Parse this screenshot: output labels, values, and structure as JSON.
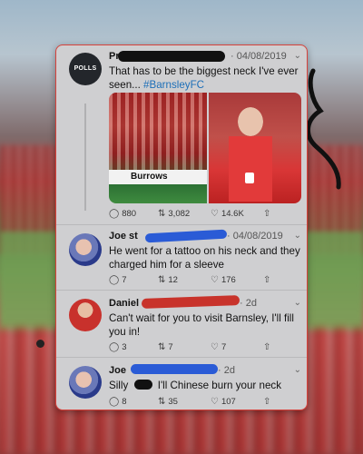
{
  "tweets": [
    {
      "avatar_label": "POLLS",
      "name": "Pri",
      "meta": "· 04/08/2019",
      "text": "That has to be the biggest neck I've ever seen... ",
      "hashtag": "#BarnsleyFC",
      "image_board_text": "Burrows",
      "actions": {
        "reply": "880",
        "retweet": "3,082",
        "like": "14.6K"
      }
    },
    {
      "name": "Joe st",
      "meta": "· 04/08/2019",
      "text": "He went for a tattoo on his neck and they charged him for a sleeve",
      "actions": {
        "reply": "7",
        "retweet": "12",
        "like": "176"
      }
    },
    {
      "name": "Daniel",
      "meta": "· 2d",
      "text": "Can't wait for you to visit Barnsley, I'll fill you in!",
      "actions": {
        "reply": "3",
        "retweet": "7",
        "like": "7"
      }
    },
    {
      "name": "Joe",
      "meta": "· 2d",
      "text_before": "Silly",
      "text_after": "I'll Chinese burn your neck",
      "actions": {
        "reply": "8",
        "retweet": "35",
        "like": "107"
      }
    }
  ],
  "icons": {
    "reply": "comment-icon",
    "retweet": "retweet-icon",
    "like": "heart-icon",
    "share": "share-icon",
    "menu": "chevron-down-icon"
  },
  "colors": {
    "redaction_black": "#111111",
    "redaction_blue": "#2a5bd6",
    "redaction_red": "#c8332b",
    "hashtag": "#1d6fb8",
    "card_border": "#d6423c"
  }
}
